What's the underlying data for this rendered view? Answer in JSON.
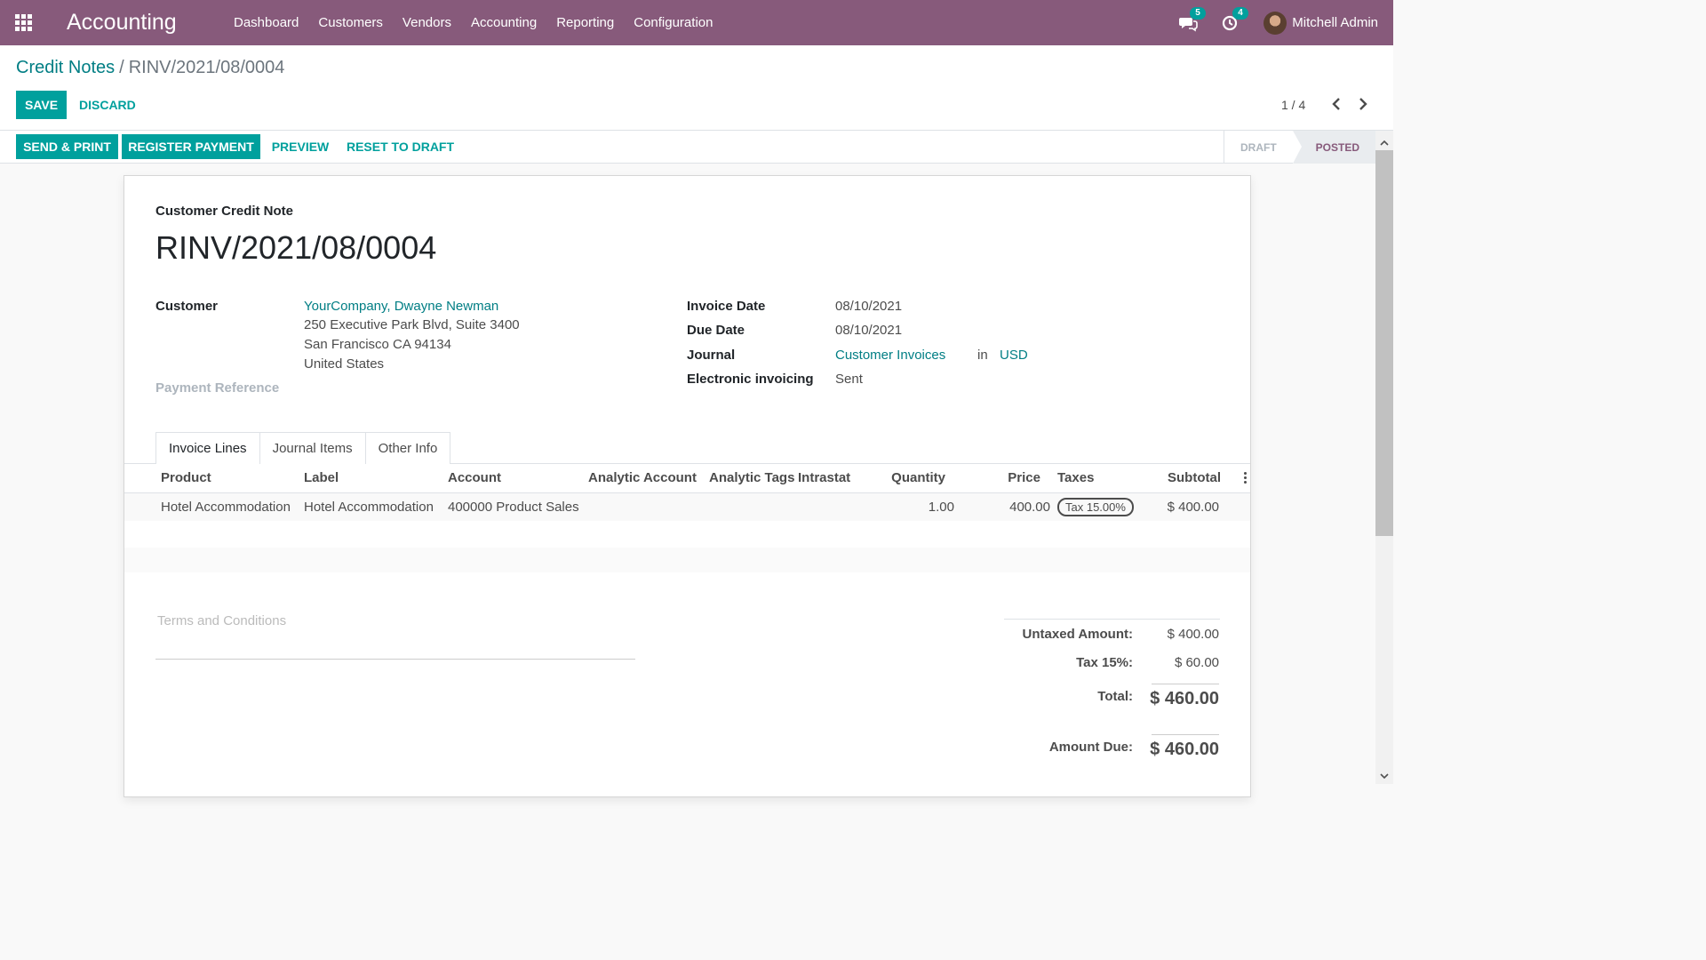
{
  "navbar": {
    "brand": "Accounting",
    "menu": [
      "Dashboard",
      "Customers",
      "Vendors",
      "Accounting",
      "Reporting",
      "Configuration"
    ],
    "messages_count": "5",
    "activities_count": "4",
    "user_name": "Mitchell Admin"
  },
  "breadcrumb": {
    "parent": "Credit Notes",
    "separator": "/",
    "current": "RINV/2021/08/0004"
  },
  "buttons": {
    "save": "SAVE",
    "discard": "DISCARD"
  },
  "pager": {
    "value": "1 / 4"
  },
  "statusbar": {
    "send_print": "SEND & PRINT",
    "register_payment": "REGISTER PAYMENT",
    "preview": "PREVIEW",
    "reset_to_draft": "RESET TO DRAFT",
    "stages": [
      "DRAFT",
      "POSTED"
    ],
    "current_stage": "POSTED"
  },
  "document": {
    "type": "Customer Credit Note",
    "number": "RINV/2021/08/0004"
  },
  "customer": {
    "label": "Customer",
    "name": "YourCompany, Dwayne Newman",
    "address_line1": "250 Executive Park Blvd, Suite 3400",
    "address_line2": "San Francisco CA 94134",
    "address_line3": "United States"
  },
  "payment_reference": {
    "label": "Payment Reference"
  },
  "invoice_info": {
    "invoice_date_label": "Invoice Date",
    "invoice_date": "08/10/2021",
    "due_date_label": "Due Date",
    "due_date": "08/10/2021",
    "journal_label": "Journal",
    "journal": "Customer Invoices",
    "in_label": "in",
    "currency": "USD",
    "einvoicing_label": "Electronic invoicing",
    "einvoicing": "Sent"
  },
  "tabs": [
    "Invoice Lines",
    "Journal Items",
    "Other Info"
  ],
  "table": {
    "headers": {
      "product": "Product",
      "label": "Label",
      "account": "Account",
      "analytic_account": "Analytic Account",
      "analytic_tags": "Analytic Tags",
      "intrastat": "Intrastat",
      "quantity": "Quantity",
      "price": "Price",
      "taxes": "Taxes",
      "subtotal": "Subtotal"
    },
    "rows": [
      {
        "product": "Hotel Accommodation",
        "label": "Hotel Accommodation",
        "account": "400000 Product Sales",
        "quantity": "1.00",
        "price": "400.00",
        "tax": "Tax 15.00%",
        "subtotal": "$ 400.00"
      }
    ]
  },
  "terms": {
    "placeholder": "Terms and Conditions"
  },
  "totals": {
    "untaxed_label": "Untaxed Amount:",
    "untaxed": "$ 400.00",
    "tax_label": "Tax 15%:",
    "tax": "$ 60.00",
    "total_label": "Total:",
    "total": "$ 460.00",
    "due_label": "Amount Due:",
    "due": "$ 460.00"
  },
  "colors": {
    "navbar": "#875a7b",
    "primary": "#00a09d",
    "link": "#017e84"
  }
}
